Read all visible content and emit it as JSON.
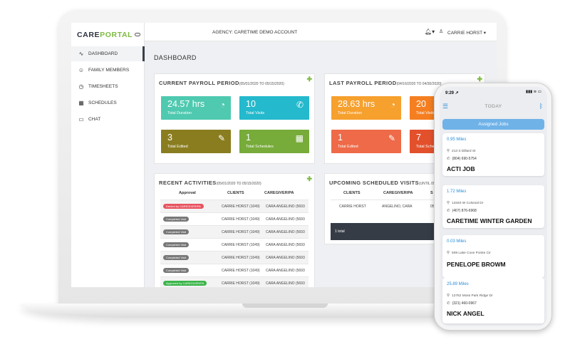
{
  "sidebar": {
    "logo_a": "CARE",
    "logo_b": "PORTAL",
    "items": [
      {
        "label": "DASHBOARD",
        "icon": "activity-icon"
      },
      {
        "label": "FAMILY MEMBERS",
        "icon": "smile-icon"
      },
      {
        "label": "TIMESHEETS",
        "icon": "clock-icon"
      },
      {
        "label": "SCHEDULES",
        "icon": "calendar-icon"
      },
      {
        "label": "CHAT",
        "icon": "chat-icon"
      }
    ]
  },
  "topbar": {
    "agency": "AGENCY: CARETIME DEMO ACCOUNT",
    "user": "CARRIE HORST"
  },
  "page_title": "DASHBOARD",
  "current_payroll": {
    "title": "CURRENT PAYROLL PERIOD",
    "range": "(05/01/2020 TO 05/15/2020)",
    "tiles": [
      {
        "value": "24.57 hrs",
        "label": "Total Duration",
        "color": "#4fc9b0"
      },
      {
        "value": "10",
        "label": "Total Visits",
        "color": "#24b9cd"
      },
      {
        "value": "3",
        "label": "Total Edited",
        "color": "#8a7d20"
      },
      {
        "value": "1",
        "label": "Total Schedules",
        "color": "#77ab3a"
      }
    ]
  },
  "last_payroll": {
    "title": "LAST PAYROLL PERIOD",
    "range": "(04/16/2020 TO 04/30/2020)",
    "tiles": [
      {
        "value": "28.63 hrs",
        "label": "Total Duration",
        "color": "#f6a02e"
      },
      {
        "value": "20",
        "label": "Total Visits",
        "color": "#f57f20"
      },
      {
        "value": "1",
        "label": "Total Edited",
        "color": "#ee6a48"
      },
      {
        "value": "7",
        "label": "Total Schedules",
        "color": "#e3512c"
      }
    ]
  },
  "recent": {
    "title": "RECENT ACTIVITIES",
    "range": "(05/01/2020 TO 05/15/2020)",
    "headers": [
      "Approval",
      "CLIENTS",
      "CAREGIVER/PA"
    ],
    "rows": [
      {
        "status": "Denied by CAREGIVER/PA",
        "client": "CARRIE HORST (1049)",
        "caregiver": "CARA ANGELINO (5693"
      },
      {
        "status": "Completed Visit",
        "client": "CARRIE HORST (1049)",
        "caregiver": "CARA ANGELINO (5693"
      },
      {
        "status": "Completed Visit",
        "client": "CARRIE HORST (1049)",
        "caregiver": "CARA ANGELINO (5693"
      },
      {
        "status": "Completed Visit",
        "client": "CARRIE HORST (1049)",
        "caregiver": "CARA ANGELINO (5693"
      },
      {
        "status": "Completed Visit",
        "client": "CARRIE HORST (1049)",
        "caregiver": "CARA ANGELINO (5693"
      },
      {
        "status": "Completed Visit",
        "client": "CARRIE HORST (1049)",
        "caregiver": "CARA ANGELINO (5693"
      },
      {
        "status": "Approved by CAREGIVER/PA",
        "client": "CARRIE HORST (1049)",
        "caregiver": "CARA ANGELINO (5693"
      }
    ]
  },
  "upcoming": {
    "title": "UPCOMING SCHEDULED VISITS",
    "range": "(UNTIL 05",
    "headers": [
      "CLIENTS",
      "CAREGIVER/PA",
      "S"
    ],
    "row": {
      "client": "CARRIE HORST",
      "caregiver": "ANGELINO, CARA",
      "extra": "05"
    },
    "total": "1 total"
  },
  "phone": {
    "time": "9:29",
    "title": "TODAY",
    "assigned": "Assigned Jobs",
    "jobs": [
      {
        "miles": "0.95 Miles",
        "address": "213 S Dillard St",
        "phone": "(804) 690-5754",
        "name": "ACTI JOB"
      },
      {
        "miles": "1.72 Miles",
        "address": "13340 W Colonial Dr",
        "phone": "(407) 876-6968",
        "name": "CARETIME WINTER GARDEN"
      },
      {
        "miles": "0.03 Miles",
        "address": "509 Lake Cove Pointe Cir",
        "phone": "",
        "name": "PENELOPE BROWM"
      },
      {
        "miles": "25.89 Miles",
        "address": "12762 Moss Park Ridge Dr",
        "phone": "(321) 460-0967",
        "name": "NICK ANGEL"
      }
    ]
  }
}
